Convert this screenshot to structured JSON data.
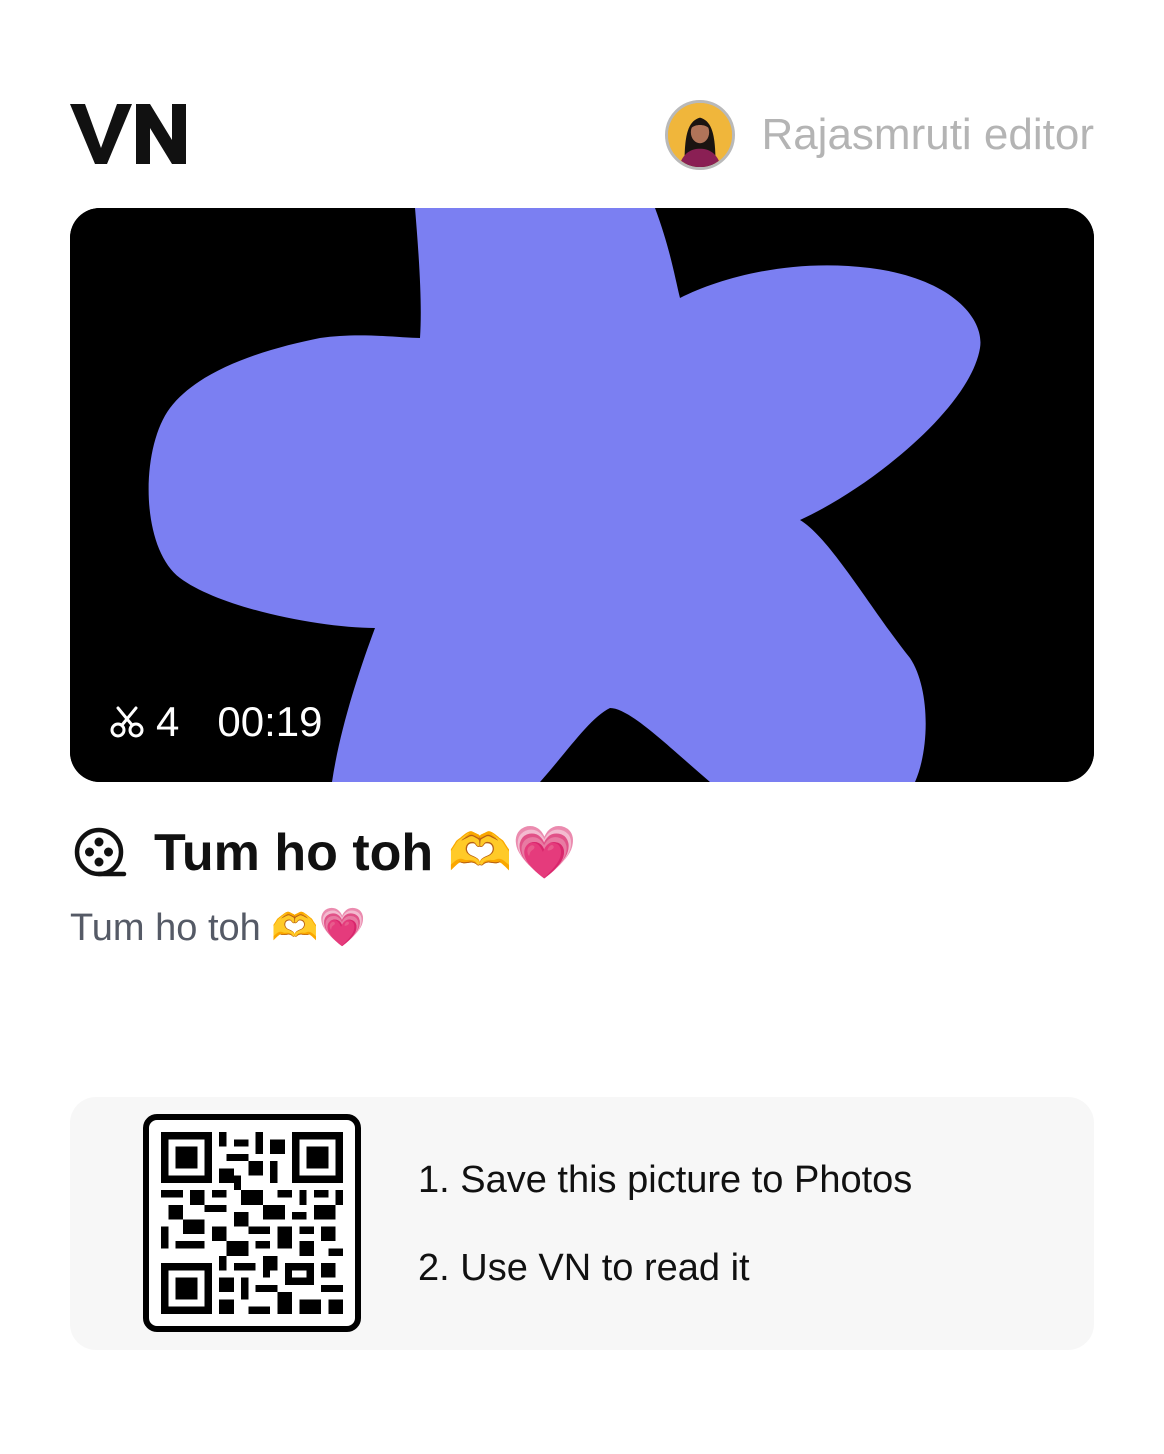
{
  "header": {
    "logo_text": "VN",
    "author_name": "Rajasmruti editor",
    "avatar_icon": "avatar-photo"
  },
  "preview": {
    "thumbnail_color": "#7b7ff2",
    "clip_count": "4",
    "duration": "00:19",
    "clip_icon": "scissors-icon"
  },
  "project": {
    "title": "Tum ho toh 🫶💗",
    "description": "Tum ho toh 🫶💗",
    "title_icon": "film-reel-icon"
  },
  "qr_card": {
    "step1": "1. Save this picture to Photos",
    "step2": "2. Use VN to read it"
  }
}
